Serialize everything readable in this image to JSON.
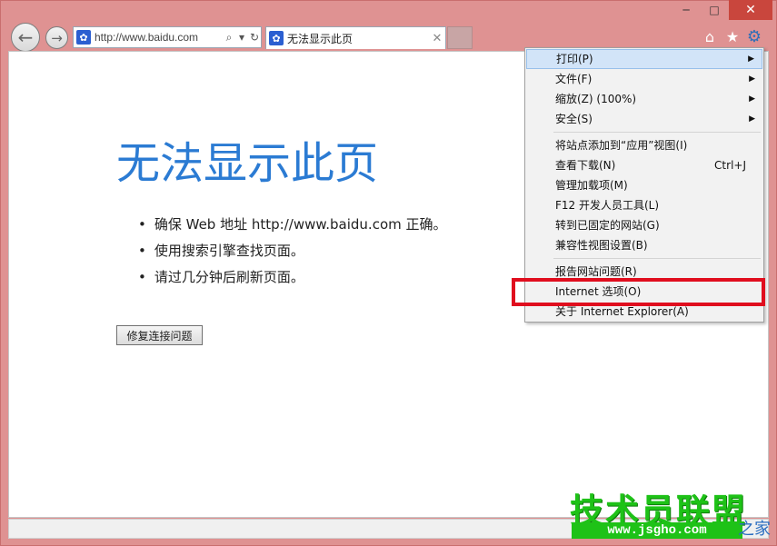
{
  "window": {
    "minimize": "─",
    "maximize": "□",
    "close": "✕"
  },
  "nav": {
    "back_icon": "←",
    "forward_icon": "→",
    "address": "http://www.baidu.com",
    "search_icon": "⌕",
    "dropdown_icon": "▾",
    "refresh_icon": "↻",
    "favicon": "✿"
  },
  "tab": {
    "title": "无法显示此页",
    "close": "✕"
  },
  "toolbar": {
    "home_icon": "⌂",
    "favorites_icon": "★",
    "tools_icon": "⚙"
  },
  "page": {
    "title": "无法显示此页",
    "bullets": [
      "确保 Web 地址 http://www.baidu.com 正确。",
      "使用搜索引擎查找页面。",
      "请过几分钟后刷新页面。"
    ],
    "fix_button": "修复连接问题"
  },
  "menu": {
    "items": [
      {
        "label": "打印(P)",
        "submenu": true,
        "highlighted": true
      },
      {
        "label": "文件(F)",
        "submenu": true
      },
      {
        "label": "缩放(Z) (100%)",
        "submenu": true
      },
      {
        "label": "安全(S)",
        "submenu": true
      },
      {
        "label": "将站点添加到“应用”视图(I)"
      },
      {
        "label": "查看下载(N)",
        "shortcut": "Ctrl+J"
      },
      {
        "label": "管理加载项(M)"
      },
      {
        "label": "F12 开发人员工具(L)"
      },
      {
        "label": "转到已固定的网站(G)"
      },
      {
        "label": "兼容性视图设置(B)"
      },
      {
        "label": "报告网站问题(R)"
      },
      {
        "label": "Internet 选项(O)",
        "boxed": true
      },
      {
        "label": "关于 Internet Explorer(A)"
      }
    ],
    "submenu_arrow": "▶"
  },
  "watermark": {
    "brand": "技术员联盟",
    "url": "www.jsgho.com",
    "suffix": "之家"
  },
  "colors": {
    "frame": "#df9292",
    "title_blue": "#2b7bd3",
    "highlight": "#d2e4f8",
    "red_box": "#e00e1e",
    "watermark_green": "#1ec217"
  }
}
